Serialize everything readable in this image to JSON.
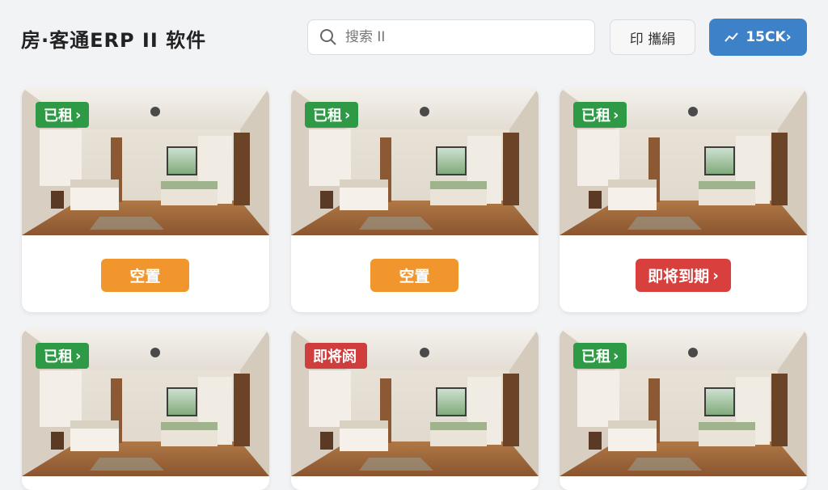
{
  "app": {
    "title": "房·客通ERP II 软件"
  },
  "search": {
    "placeholder": "搜索 II"
  },
  "toolbar": {
    "print_label": "印 攜絹",
    "main_label": "15CK›"
  },
  "cards": [
    {
      "tag": "已租",
      "tag_arrow": "›",
      "tag_color": "#2e9a45",
      "status": "空置",
      "status_arrow": "",
      "status_color": "#f0962c"
    },
    {
      "tag": "已租",
      "tag_arrow": "›",
      "tag_color": "#2e9a45",
      "status": "空置",
      "status_arrow": "",
      "status_color": "#f0962c"
    },
    {
      "tag": "已租",
      "tag_arrow": "›",
      "tag_color": "#2e9a45",
      "status": "即将到期",
      "status_arrow": "›",
      "status_color": "#d8403e"
    },
    {
      "tag": "已租",
      "tag_arrow": "›",
      "tag_color": "#2e9a45"
    },
    {
      "tag": "即将阏",
      "tag_arrow": "",
      "tag_color": "#cf3d3d"
    },
    {
      "tag": "已租",
      "tag_arrow": "›",
      "tag_color": "#2e9a45"
    }
  ]
}
